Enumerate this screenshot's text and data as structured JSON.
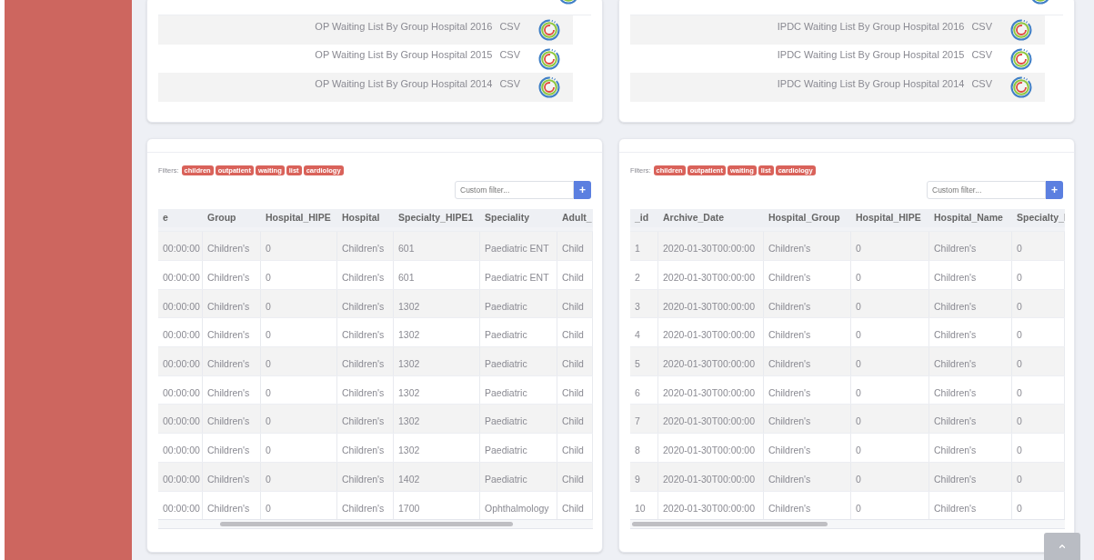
{
  "dataset_lists": [
    {
      "items": [
        {
          "title": "OP Waiting List By Group Hospital 2016",
          "format": "CSV"
        },
        {
          "title": "OP Waiting List By Group Hospital 2015",
          "format": "CSV"
        },
        {
          "title": "OP Waiting List By Group Hospital 2014",
          "format": "CSV"
        }
      ]
    },
    {
      "items": [
        {
          "title": "IPDC Waiting List By Group Hospital 2016",
          "format": "CSV"
        },
        {
          "title": "IPDC Waiting List By Group Hospital 2015",
          "format": "CSV"
        },
        {
          "title": "IPDC Waiting List By Group Hospital 2014",
          "format": "CSV"
        }
      ]
    }
  ],
  "tables": [
    {
      "filters_label": "Filters:",
      "filters": [
        "children",
        "outpatient",
        "waiting",
        "list",
        "cardiology"
      ],
      "custom_filter": {
        "placeholder": "Custom filter..."
      },
      "add_button": "+",
      "columns": [
        "e",
        "Group",
        "Hospital_HIPE",
        "Hospital",
        "Specialty_HIPE1",
        "Speciality",
        "Adult_"
      ],
      "rows": [
        [
          "00:00:00",
          "Children's",
          "0",
          "Children's",
          "601",
          "Paediatric ENT",
          "Child"
        ],
        [
          "00:00:00",
          "Children's",
          "0",
          "Children's",
          "601",
          "Paediatric ENT",
          "Child"
        ],
        [
          "00:00:00",
          "Children's",
          "0",
          "Children's",
          "1302",
          "Paediatric",
          "Child"
        ],
        [
          "00:00:00",
          "Children's",
          "0",
          "Children's",
          "1302",
          "Paediatric",
          "Child"
        ],
        [
          "00:00:00",
          "Children's",
          "0",
          "Children's",
          "1302",
          "Paediatric",
          "Child"
        ],
        [
          "00:00:00",
          "Children's",
          "0",
          "Children's",
          "1302",
          "Paediatric",
          "Child"
        ],
        [
          "00:00:00",
          "Children's",
          "0",
          "Children's",
          "1302",
          "Paediatric",
          "Child"
        ],
        [
          "00:00:00",
          "Children's",
          "0",
          "Children's",
          "1302",
          "Paediatric",
          "Child"
        ],
        [
          "00:00:00",
          "Children's",
          "0",
          "Children's",
          "1402",
          "Paediatric",
          "Child"
        ],
        [
          "00:00:00",
          "Children's",
          "0",
          "Children's",
          "1700",
          "Ophthalmology",
          "Child"
        ]
      ]
    },
    {
      "filters_label": "Filters:",
      "filters": [
        "children",
        "outpatient",
        "waiting",
        "list",
        "cardiology"
      ],
      "custom_filter": {
        "placeholder": "Custom filter..."
      },
      "add_button": "+",
      "columns": [
        "_id",
        "Archive_Date",
        "Hospital_Group",
        "Hospital_HIPE",
        "Hospital_Name",
        "Specialty_I"
      ],
      "rows": [
        [
          "1",
          "2020-01-30T00:00:00",
          "Children's",
          "0",
          "Children's",
          "0"
        ],
        [
          "2",
          "2020-01-30T00:00:00",
          "Children's",
          "0",
          "Children's",
          "0"
        ],
        [
          "3",
          "2020-01-30T00:00:00",
          "Children's",
          "0",
          "Children's",
          "0"
        ],
        [
          "4",
          "2020-01-30T00:00:00",
          "Children's",
          "0",
          "Children's",
          "0"
        ],
        [
          "5",
          "2020-01-30T00:00:00",
          "Children's",
          "0",
          "Children's",
          "0"
        ],
        [
          "6",
          "2020-01-30T00:00:00",
          "Children's",
          "0",
          "Children's",
          "0"
        ],
        [
          "7",
          "2020-01-30T00:00:00",
          "Children's",
          "0",
          "Children's",
          "0"
        ],
        [
          "8",
          "2020-01-30T00:00:00",
          "Children's",
          "0",
          "Children's",
          "0"
        ],
        [
          "9",
          "2020-01-30T00:00:00",
          "Children's",
          "0",
          "Children's",
          "0"
        ],
        [
          "10",
          "2020-01-30T00:00:00",
          "Children's",
          "0",
          "Children's",
          "0"
        ]
      ]
    }
  ]
}
